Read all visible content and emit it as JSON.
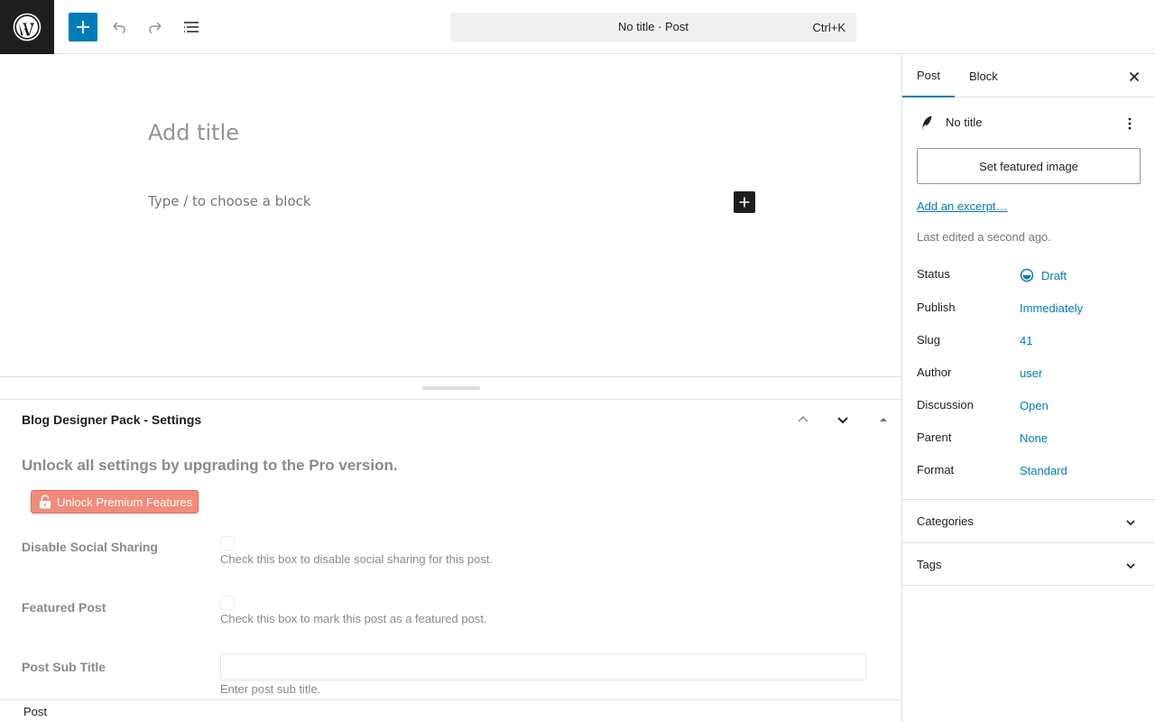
{
  "toolbar": {
    "logo_icon": "wordpress-logo-icon",
    "inserter_icon": "plus-icon",
    "undo_icon": "undo-icon",
    "redo_icon": "redo-icon",
    "document_overview_icon": "list-view-icon",
    "command_bar_title": "No title · Post",
    "command_bar_shortcut": "Ctrl+K",
    "accent_color": "#007cba"
  },
  "editor": {
    "title_placeholder": "Add title",
    "block_placeholder": "Type / to choose a block"
  },
  "metabox": {
    "title": "Blog Designer Pack - Settings",
    "heading": "Unlock all settings by upgrading to the Pro version.",
    "premium_button": "Unlock Premium Features",
    "fields": [
      {
        "label": "Disable Social Sharing",
        "description": "Check this box to disable social sharing for this post."
      },
      {
        "label": "Featured Post",
        "description": "Check this box to mark this post as a featured post."
      },
      {
        "label": "Post Sub Title",
        "description": "Enter post sub title."
      }
    ]
  },
  "footer": {
    "breadcrumb": "Post"
  },
  "sidebar": {
    "tabs": [
      {
        "label": "Post",
        "active": true
      },
      {
        "label": "Block",
        "active": false
      }
    ],
    "post_title": "No title",
    "featured_image_button": "Set featured image",
    "excerpt_link": "Add an excerpt…",
    "last_edited": "Last edited a second ago.",
    "meta": [
      {
        "key": "Status",
        "value": "Draft"
      },
      {
        "key": "Publish",
        "value": "Immediately"
      },
      {
        "key": "Slug",
        "value": "41"
      },
      {
        "key": "Author",
        "value": "user"
      },
      {
        "key": "Discussion",
        "value": "Open"
      },
      {
        "key": "Parent",
        "value": "None"
      },
      {
        "key": "Format",
        "value": "Standard"
      }
    ],
    "panels": [
      {
        "title": "Categories"
      },
      {
        "title": "Tags"
      }
    ]
  }
}
